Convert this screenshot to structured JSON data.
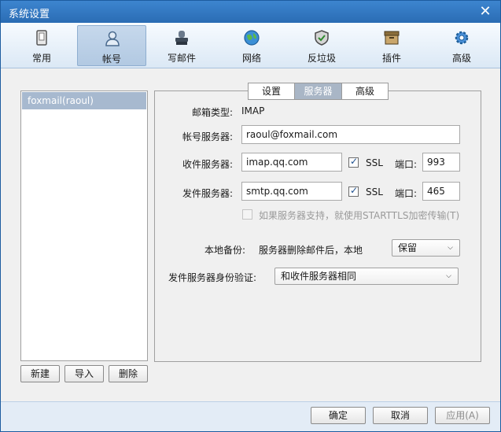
{
  "window": {
    "title": "系统设置"
  },
  "toolbar": [
    {
      "label": "常用",
      "icon": "phone-icon"
    },
    {
      "label": "帐号",
      "icon": "user-icon",
      "active": true
    },
    {
      "label": "写邮件",
      "icon": "stamp-icon"
    },
    {
      "label": "网络",
      "icon": "globe-icon"
    },
    {
      "label": "反垃圾",
      "icon": "shield-icon"
    },
    {
      "label": "插件",
      "icon": "box-icon"
    },
    {
      "label": "高级",
      "icon": "gear-icon"
    }
  ],
  "accounts": {
    "items": [
      "foxmail(raoul)"
    ]
  },
  "account_buttons": {
    "new": "新建",
    "import": "导入",
    "delete": "删除"
  },
  "tabs": {
    "settings": "设置",
    "server": "服务器",
    "advanced": "高级"
  },
  "form": {
    "mailbox_type_label": "邮箱类型:",
    "mailbox_type_value": "IMAP",
    "account_server_label": "帐号服务器:",
    "account_server_value": "raoul@foxmail.com",
    "incoming_label": "收件服务器:",
    "incoming_value": "imap.qq.com",
    "incoming_ssl": "SSL",
    "incoming_port_label": "端口:",
    "incoming_port": "993",
    "outgoing_label": "发件服务器:",
    "outgoing_value": "smtp.qq.com",
    "outgoing_ssl": "SSL",
    "outgoing_port_label": "端口:",
    "outgoing_port": "465",
    "starttls_label": "如果服务器支持，就使用STARTTLS加密传输(T)",
    "backup_label": "本地备份:",
    "backup_desc": "服务器删除邮件后，本地",
    "backup_value": "保留",
    "auth_label": "发件服务器身份验证:",
    "auth_value": "和收件服务器相同"
  },
  "footer": {
    "ok": "确定",
    "cancel": "取消",
    "apply": "应用(A)"
  }
}
